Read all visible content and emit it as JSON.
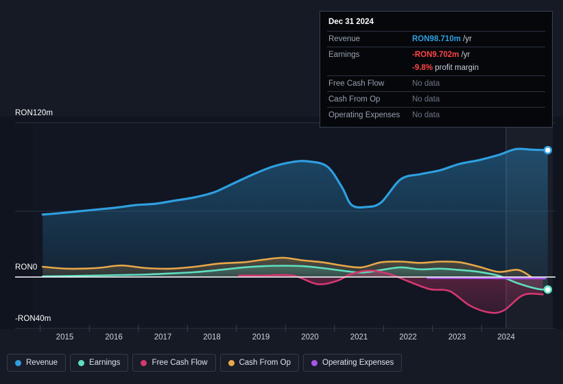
{
  "currency": "RON",
  "colors": {
    "revenue": "#2f9fe0",
    "earnings": "#5fdfc0",
    "free_cash_flow": "#d4386f",
    "cash_from_op": "#e8a849",
    "operating_expenses": "#a855e8",
    "background": "#151a25",
    "plot_background": "#10141e",
    "zero_line": "#ffffff",
    "grid": "#2b3240",
    "tooltip_background": "#05070b",
    "tooltip_border": "#3a4152",
    "negative_value": "#ff4545"
  },
  "tooltip": {
    "title": "Dec 31 2024",
    "rows": [
      {
        "key": "Revenue",
        "value": "RON98.710m",
        "unit": " /yr",
        "state": "value",
        "color": "#2f9fe0"
      },
      {
        "key": "Earnings",
        "value": "-RON9.702m",
        "unit": " /yr",
        "state": "value",
        "color": "#ff4545"
      },
      {
        "key": "",
        "value": "-9.8%",
        "unit": " profit margin",
        "state": "sub",
        "color": "#ff4545"
      },
      {
        "key": "Free Cash Flow",
        "value": "No data",
        "unit": "",
        "state": "nodata",
        "color": "#6e7686"
      },
      {
        "key": "Cash From Op",
        "value": "No data",
        "unit": "",
        "state": "nodata",
        "color": "#6e7686"
      },
      {
        "key": "Operating Expenses",
        "value": "No data",
        "unit": "",
        "state": "nodata",
        "color": "#6e7686"
      }
    ]
  },
  "legend": {
    "items": [
      {
        "label": "Revenue",
        "color": "#2f9fe0"
      },
      {
        "label": "Earnings",
        "color": "#5fdfc0"
      },
      {
        "label": "Free Cash Flow",
        "color": "#d4386f"
      },
      {
        "label": "Cash From Op",
        "color": "#e8a849"
      },
      {
        "label": "Operating Expenses",
        "color": "#a855e8"
      }
    ]
  },
  "axes": {
    "y_labels": [
      {
        "text": "RON120m",
        "value": 120
      },
      {
        "text": "RON0",
        "value": 0
      },
      {
        "text": "-RON40m",
        "value": -40
      }
    ],
    "x_labels": [
      "2015",
      "2016",
      "2017",
      "2018",
      "2019",
      "2020",
      "2021",
      "2022",
      "2023",
      "2024"
    ]
  },
  "chart_data": {
    "type": "area",
    "title": "",
    "xlabel": "",
    "ylabel": "RON",
    "ylim": [
      -40,
      120
    ],
    "xlim": [
      2014.5,
      2025.1
    ],
    "grid": true,
    "legend_position": "bottom",
    "x_tick_labels": [
      "2015",
      "2016",
      "2017",
      "2018",
      "2019",
      "2020",
      "2021",
      "2022",
      "2023",
      "2024"
    ],
    "y_tick_labels": [
      "RON120m",
      "RON0",
      "-RON40m"
    ],
    "highlight_band": {
      "from_x": 2024.15,
      "to_x": 2025.1
    },
    "series": [
      {
        "name": "Revenue",
        "color": "#2f9fe0",
        "unit": "RON m",
        "x": [
          2014.7,
          2015.0,
          2015.4,
          2015.8,
          2016.2,
          2016.6,
          2017.0,
          2017.4,
          2017.8,
          2018.2,
          2018.6,
          2019.0,
          2019.4,
          2019.8,
          2020.1,
          2020.5,
          2020.8,
          2021.0,
          2021.3,
          2021.6,
          2022.0,
          2022.4,
          2022.8,
          2023.2,
          2023.6,
          2024.0,
          2024.35,
          2024.7,
          2025.0
        ],
        "values": [
          48.6,
          49.5,
          51.0,
          52.5,
          54.0,
          56.0,
          57.0,
          59.5,
          62.0,
          66.0,
          73.0,
          80.0,
          86.0,
          89.5,
          90.0,
          86.0,
          70.0,
          56.0,
          54.5,
          58.0,
          76.0,
          80.0,
          83.0,
          88.0,
          91.0,
          95.0,
          99.5,
          99.0,
          98.7
        ]
      },
      {
        "name": "Earnings",
        "color": "#5fdfc0",
        "unit": "RON m",
        "x": [
          2014.7,
          2015.2,
          2015.8,
          2016.3,
          2016.8,
          2017.3,
          2017.8,
          2018.3,
          2018.8,
          2019.2,
          2019.6,
          2020.0,
          2020.4,
          2020.8,
          2021.2,
          2021.6,
          2022.0,
          2022.4,
          2022.8,
          2023.2,
          2023.6,
          2024.0,
          2024.4,
          2024.8,
          2025.0
        ],
        "values": [
          0.5,
          0.8,
          1.2,
          1.6,
          2.0,
          2.8,
          3.8,
          5.5,
          7.5,
          8.5,
          8.8,
          8.5,
          7.0,
          5.0,
          3.5,
          5.5,
          7.5,
          6.0,
          6.5,
          5.5,
          4.0,
          1.0,
          -5.0,
          -9.3,
          -9.7
        ]
      },
      {
        "name": "Free Cash Flow",
        "color": "#d4386f",
        "unit": "RON m",
        "x": [
          2018.7,
          2019.2,
          2019.8,
          2020.3,
          2020.7,
          2021.0,
          2021.4,
          2021.8,
          2022.2,
          2022.6,
          2023.0,
          2023.4,
          2023.8,
          2024.1,
          2024.5,
          2024.9
        ],
        "values": [
          1.2,
          1.2,
          1.2,
          -5.5,
          -3.0,
          2.5,
          5.0,
          2.0,
          -4.0,
          -9.5,
          -11.0,
          -22.0,
          -27.5,
          -26.0,
          -14.0,
          -13.5
        ]
      },
      {
        "name": "Cash From Op",
        "color": "#e8a849",
        "unit": "RON m",
        "x": [
          2014.7,
          2015.2,
          2015.8,
          2016.3,
          2016.8,
          2017.3,
          2017.8,
          2018.3,
          2018.8,
          2019.2,
          2019.6,
          2020.0,
          2020.4,
          2020.8,
          2021.2,
          2021.6,
          2022.0,
          2022.4,
          2022.8,
          2023.2,
          2023.6,
          2024.0,
          2024.4,
          2024.7
        ],
        "values": [
          8.0,
          6.5,
          7.0,
          9.0,
          7.0,
          6.5,
          8.0,
          10.5,
          11.5,
          13.5,
          15.0,
          13.0,
          11.5,
          9.0,
          7.5,
          11.5,
          12.0,
          11.0,
          12.0,
          11.5,
          8.0,
          4.0,
          5.5,
          -1.0
        ]
      },
      {
        "name": "Operating Expenses",
        "color": "#a855e8",
        "unit": "RON m",
        "x": [
          2022.55,
          2023.2,
          2023.8,
          2024.4,
          2024.95
        ],
        "values": [
          -0.6,
          -0.7,
          -0.8,
          -0.9,
          -1.0
        ]
      }
    ]
  }
}
